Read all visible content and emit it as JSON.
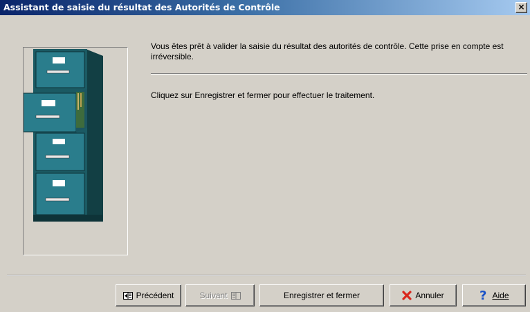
{
  "window": {
    "title": "Assistant de saisie du résultat des Autorités de Contrôle",
    "close_label": "×"
  },
  "content": {
    "message_1": "Vous êtes prêt à valider la saisie du résultat des autorités de contrôle. Cette prise en compte est  irréversible.",
    "message_2": "Cliquez sur Enregistrer et fermer pour effectuer le traitement."
  },
  "buttons": {
    "previous": "Précédent",
    "next": "Suivant",
    "save_close": "Enregistrer et fermer",
    "cancel": "Annuler",
    "help": "Aide"
  },
  "icons": {
    "illustration": "filing-cabinet-icon",
    "previous": "previous-arrow-icon",
    "next": "next-arrow-icon",
    "cancel": "red-x-icon",
    "help": "question-mark-icon"
  },
  "colors": {
    "title_start": "#0a246a",
    "title_end": "#a6caf0",
    "cabinet": "#2a7d8c",
    "cancel_icon": "#d9261c",
    "help_icon": "#1a52c8"
  }
}
